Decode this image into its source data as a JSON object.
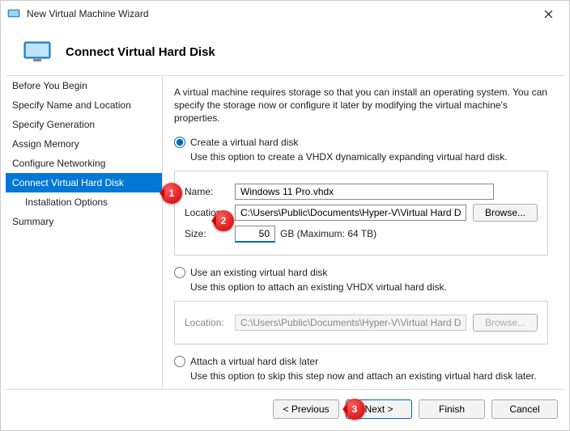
{
  "window": {
    "title": "New Virtual Machine Wizard"
  },
  "header": {
    "title": "Connect Virtual Hard Disk"
  },
  "sidebar": {
    "items": [
      {
        "label": "Before You Begin"
      },
      {
        "label": "Specify Name and Location"
      },
      {
        "label": "Specify Generation"
      },
      {
        "label": "Assign Memory"
      },
      {
        "label": "Configure Networking"
      },
      {
        "label": "Connect Virtual Hard Disk"
      },
      {
        "label": "Installation Options"
      },
      {
        "label": "Summary"
      }
    ]
  },
  "content": {
    "intro": "A virtual machine requires storage so that you can install an operating system. You can specify the storage now or configure it later by modifying the virtual machine's properties.",
    "opt1": {
      "label": "Create a virtual hard disk",
      "desc": "Use this option to create a VHDX dynamically expanding virtual hard disk.",
      "name_lbl": "Name:",
      "name_val": "Windows 11 Pro.vhdx",
      "loc_lbl": "Location:",
      "loc_val": "C:\\Users\\Public\\Documents\\Hyper-V\\Virtual Hard Disks\\",
      "browse": "Browse...",
      "size_lbl": "Size:",
      "size_val": "50",
      "size_unit": "GB (Maximum: 64 TB)"
    },
    "opt2": {
      "label": "Use an existing virtual hard disk",
      "desc": "Use this option to attach an existing VHDX virtual hard disk.",
      "loc_lbl": "Location:",
      "loc_val": "C:\\Users\\Public\\Documents\\Hyper-V\\Virtual Hard Disks\\",
      "browse": "Browse..."
    },
    "opt3": {
      "label": "Attach a virtual hard disk later",
      "desc": "Use this option to skip this step now and attach an existing virtual hard disk later."
    }
  },
  "footer": {
    "previous": "< Previous",
    "next": "Next >",
    "finish": "Finish",
    "cancel": "Cancel"
  },
  "annotations": {
    "c1": "1",
    "c2": "2",
    "c3": "3"
  }
}
